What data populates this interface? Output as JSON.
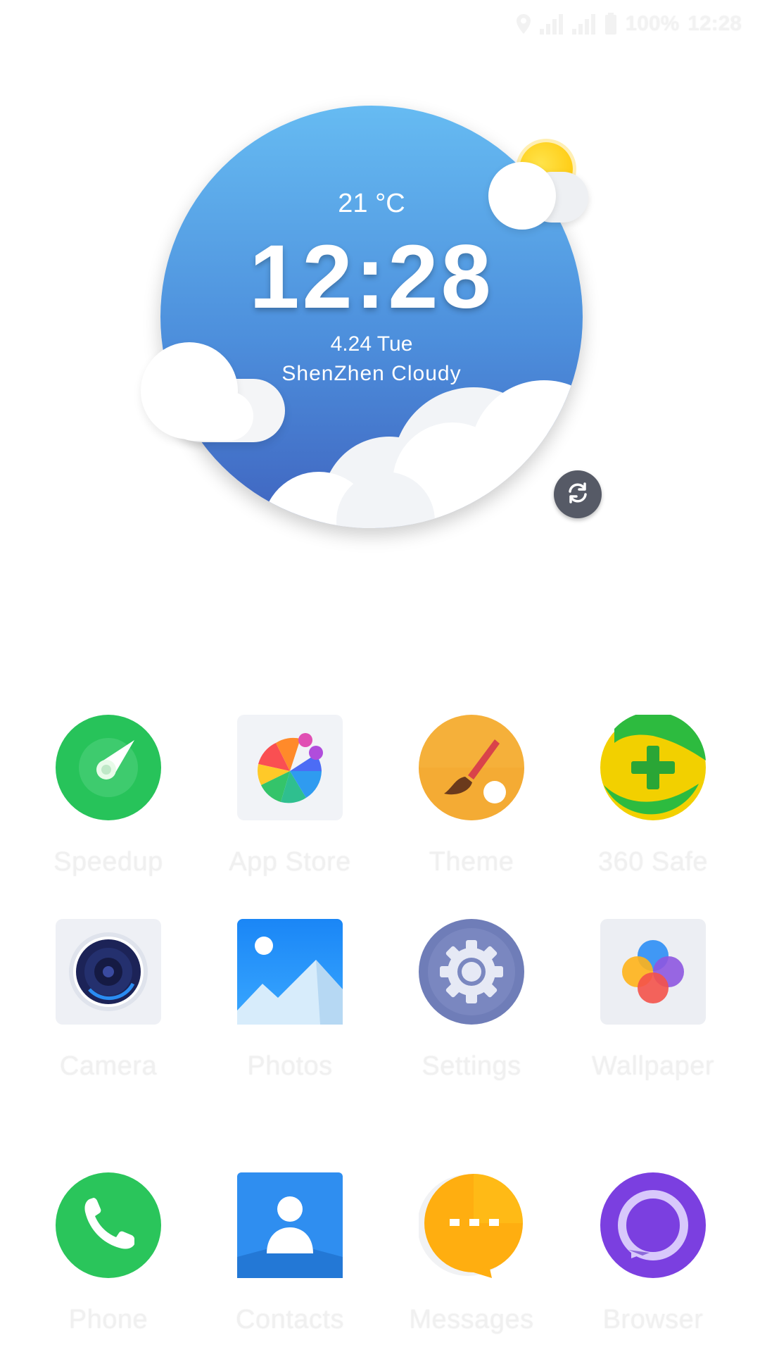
{
  "status_bar": {
    "battery_percent": "100%",
    "time": "12:28",
    "icons": [
      "location-icon",
      "signal-icon",
      "signal-icon",
      "battery-icon"
    ]
  },
  "widget": {
    "temperature": "21 °C",
    "time": "12:28",
    "date": "4.24 Tue",
    "location_weather": "ShenZhen  Cloudy",
    "weather_icon": "sun-cloud-icon",
    "refresh_icon": "refresh-icon"
  },
  "apps": {
    "row1": [
      {
        "label": "Speedup",
        "icon": "speedometer-icon",
        "color": "#2cc65a"
      },
      {
        "label": "App Store",
        "icon": "app-store-icon",
        "color": "#f2f4f8"
      },
      {
        "label": "Theme",
        "icon": "paintbrush-icon",
        "color": "#f7b43a"
      },
      {
        "label": "360 Safe",
        "icon": "plus-shield-icon",
        "color": "#f4d300"
      }
    ],
    "row2": [
      {
        "label": "Camera",
        "icon": "camera-lens-icon",
        "color": "#1e2a6b"
      },
      {
        "label": "Photos",
        "icon": "mountain-photo-icon",
        "color": "#1e8ff5"
      },
      {
        "label": "Settings",
        "icon": "gear-icon",
        "color": "#7480b8"
      },
      {
        "label": "Wallpaper",
        "icon": "color-dots-icon",
        "color": "#eef0f4"
      }
    ],
    "row3": [
      {
        "label": "Phone",
        "icon": "phone-icon",
        "color": "#2ac55b"
      },
      {
        "label": "Contacts",
        "icon": "contact-icon",
        "color": "#2e8ef0"
      },
      {
        "label": "Messages",
        "icon": "chat-bubble-icon",
        "color": "#ffae10"
      },
      {
        "label": "Browser",
        "icon": "browser-ring-icon",
        "color": "#7b3fe0"
      }
    ]
  }
}
